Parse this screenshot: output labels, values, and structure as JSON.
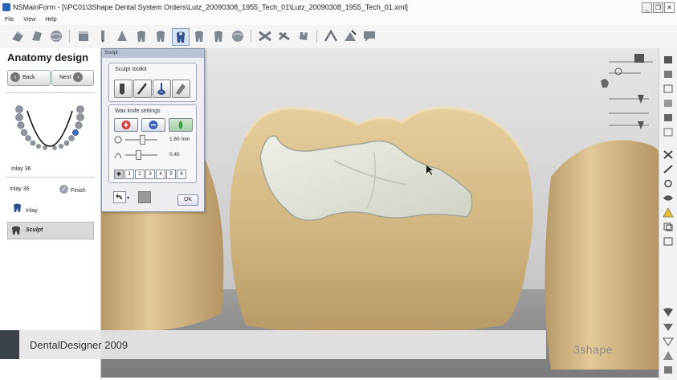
{
  "window": {
    "title": "NSMainForm - [\\\\PC01\\3Shape Dental System Orders\\Lutz_20090308_1955_Tech_01\\Lutz_20090308_1955_Tech_01.xml]",
    "minimize": "_",
    "restore": "❐",
    "close": "✕"
  },
  "menu": [
    "File",
    "View",
    "Help"
  ],
  "left_panel": {
    "title": "Anatomy design",
    "back_label": "Back",
    "next_label": "Next",
    "tooth_label": "Inlay 36",
    "item_label": "Inlay 36",
    "finish_label": "Finish",
    "inlay_label": "Inlay",
    "sculpt_label": "Sculpt"
  },
  "sculpt_dialog": {
    "title": "Sculpt",
    "toolkit_label": "Sculpt toolkit",
    "wax_knife_label": "Wax knife settings",
    "size_value": "1.60",
    "size_unit": "mm",
    "strength_value": "0.45",
    "numbers": [
      "1",
      "2",
      "3",
      "4",
      "5",
      "6"
    ],
    "ok_label": "OK"
  },
  "footer": {
    "product": "DentalDesigner 2009",
    "brand": "3shape"
  },
  "colors": {
    "tooth": "#d2b684",
    "inlay": "#dfe2d8",
    "background": "#d4d4d4",
    "panel_border": "#8a96aa"
  }
}
